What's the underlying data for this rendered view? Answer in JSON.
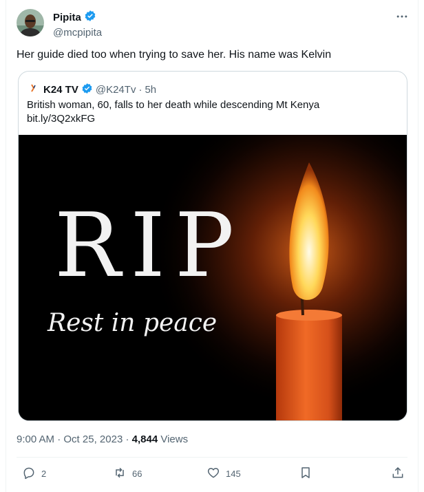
{
  "author": {
    "name": "Pipita",
    "handle": "@mcpipita",
    "verified": true,
    "icons": {
      "verified": "verified-badge-icon",
      "more": "more-options-icon"
    }
  },
  "tweet": {
    "text": "Her guide died too when trying to save her. His name was Kelvin"
  },
  "quote": {
    "author_name": "K24 TV",
    "handle": "@K24Tv",
    "separator": "·",
    "age": "5h",
    "text": "British woman, 60, falls to her death while descending Mt Kenya",
    "link": "bit.ly/3Q2xkFG",
    "image": {
      "heading": "RIP",
      "subheading": "Rest in peace"
    }
  },
  "meta": {
    "time": "9:00 AM",
    "dot": "·",
    "date": "Oct 25, 2023",
    "dot2": "·",
    "views_count": "4,844",
    "views_label": "Views"
  },
  "actions": {
    "replies": "2",
    "retweets": "66",
    "likes": "145",
    "icons": [
      "reply-icon",
      "retweet-icon",
      "like-icon",
      "bookmark-icon",
      "share-icon"
    ]
  },
  "colors": {
    "accent": "#1d9bf0",
    "secondary_text": "#536471",
    "border": "#cfd9de"
  }
}
